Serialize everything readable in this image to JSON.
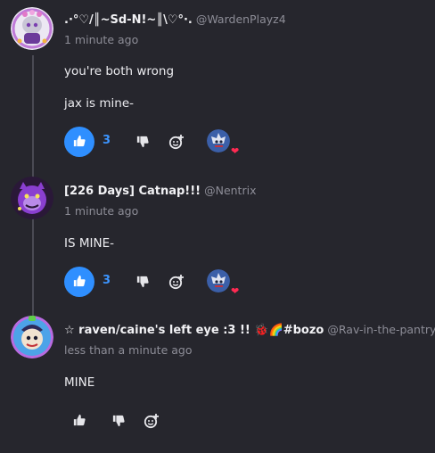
{
  "posts": [
    {
      "name": ".·°♡/║~Sd-N!~║\\♡°·.",
      "handle": "@WardenPlayz4",
      "time": "1 minute ago",
      "lines": [
        "you're both wrong",
        "jax is mine-"
      ],
      "likes": "3",
      "liked": true
    },
    {
      "name": "[226 Days] Catnap!!!",
      "handle": "@Nentrix",
      "time": "1 minute ago",
      "lines": [
        "IS MINE-"
      ],
      "likes": "3",
      "liked": true
    },
    {
      "name": "☆ raven/caine's left eye :3 !! 🐞🌈#bozo",
      "handle": "@Rav-in-the-pantry",
      "time": "less than a minute ago",
      "lines": [
        "MINE"
      ],
      "likes": "",
      "liked": false
    }
  ],
  "colors": {
    "accent": "#2f8fff",
    "heart": "#ff2a52",
    "background": "#26262d"
  },
  "icons": [
    "thumbs-up-icon",
    "thumbs-down-icon",
    "add-reaction-icon",
    "heart-icon"
  ]
}
